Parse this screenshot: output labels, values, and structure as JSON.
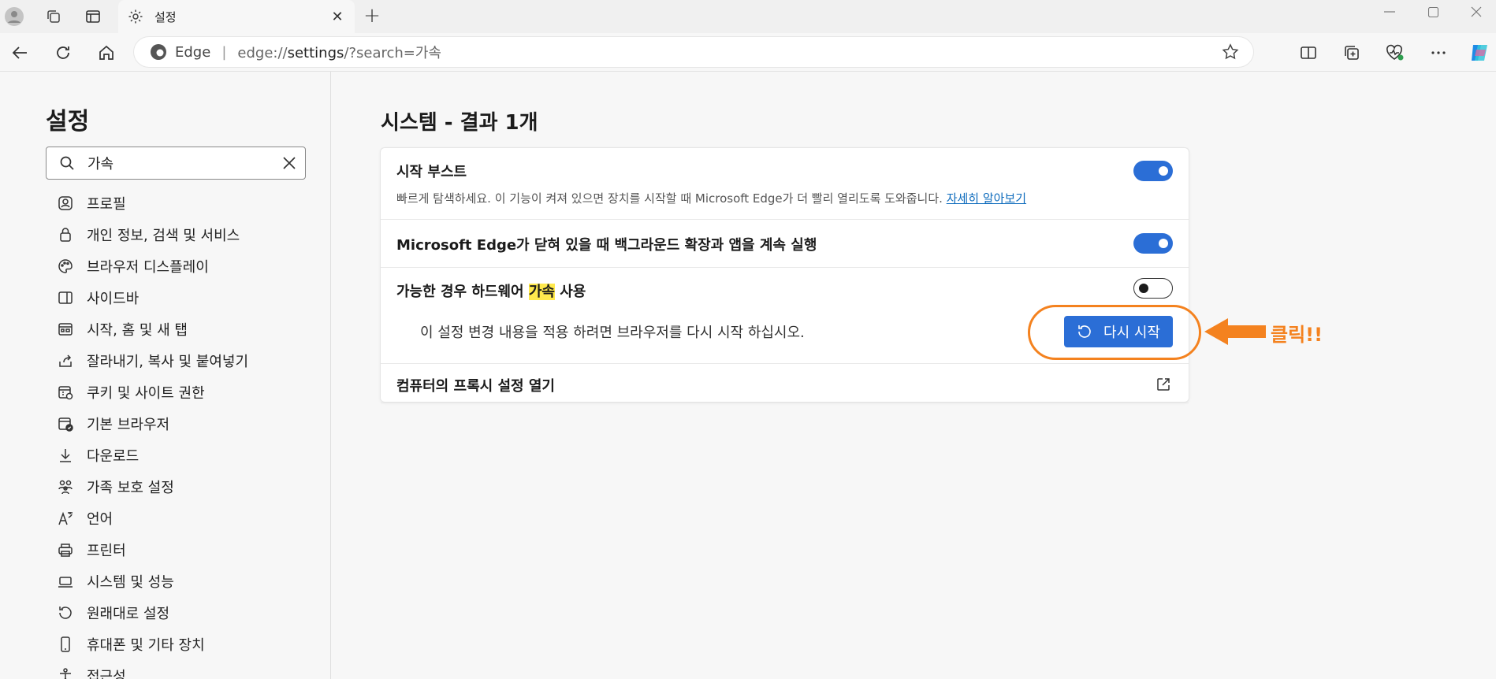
{
  "browser": {
    "tab_title": "설정",
    "brand": "Edge",
    "url_prefix": "edge://",
    "url_host": "settings",
    "url_rest": "/?search=가속"
  },
  "sidebar": {
    "title": "설정",
    "search_value": "가속",
    "items": [
      {
        "label": "프로필",
        "icon": "profile-icon"
      },
      {
        "label": "개인 정보, 검색 및 서비스",
        "icon": "lock-icon"
      },
      {
        "label": "브라우저 디스플레이",
        "icon": "palette-icon"
      },
      {
        "label": "사이드바",
        "icon": "sidebar-icon"
      },
      {
        "label": "시작, 홈 및 새 탭",
        "icon": "home-tabs-icon"
      },
      {
        "label": "잘라내기, 복사 및 붙여넣기",
        "icon": "share-icon"
      },
      {
        "label": "쿠키 및 사이트 권한",
        "icon": "cookie-icon"
      },
      {
        "label": "기본 브라우저",
        "icon": "default-browser-icon"
      },
      {
        "label": "다운로드",
        "icon": "download-icon"
      },
      {
        "label": "가족 보호 설정",
        "icon": "family-icon"
      },
      {
        "label": "언어",
        "icon": "language-icon"
      },
      {
        "label": "프린터",
        "icon": "printer-icon"
      },
      {
        "label": "시스템 및 성능",
        "icon": "laptop-icon"
      },
      {
        "label": "원래대로 설정",
        "icon": "reset-icon"
      },
      {
        "label": "휴대폰 및 기타 장치",
        "icon": "phone-icon"
      },
      {
        "label": "접근성",
        "icon": "accessibility-icon"
      }
    ]
  },
  "main": {
    "title": "시스템 - 결과 1개",
    "rows": {
      "startup_boost": {
        "label": "시작 부스트",
        "desc": "빠르게 탐색하세요. 이 기능이 켜져 있으면 장치를 시작할 때 Microsoft Edge가 더 빨리 열리도록 도와줍니다.",
        "link": "자세히 알아보기",
        "enabled": true
      },
      "background": {
        "label": "Microsoft Edge가 닫혀 있을 때 백그라운드 확장과 앱을 계속 실행",
        "enabled": true
      },
      "hardware_accel": {
        "label_pre": "가능한 경우 하드웨어 ",
        "label_hl": "가속",
        "label_post": " 사용",
        "enabled": false,
        "restart_msg": "이 설정 변경 내용을 적용 하려면 브라우저를 다시 시작 하십시오.",
        "restart_button": "다시 시작"
      },
      "proxy": {
        "label": "컴퓨터의 프록시 설정 열기"
      }
    }
  },
  "annotation": {
    "text": "클릭!!",
    "color": "#f4821f"
  },
  "colors": {
    "accent": "#2b6ed6",
    "link": "#0f6cbd",
    "highlight": "#ffe94d"
  }
}
